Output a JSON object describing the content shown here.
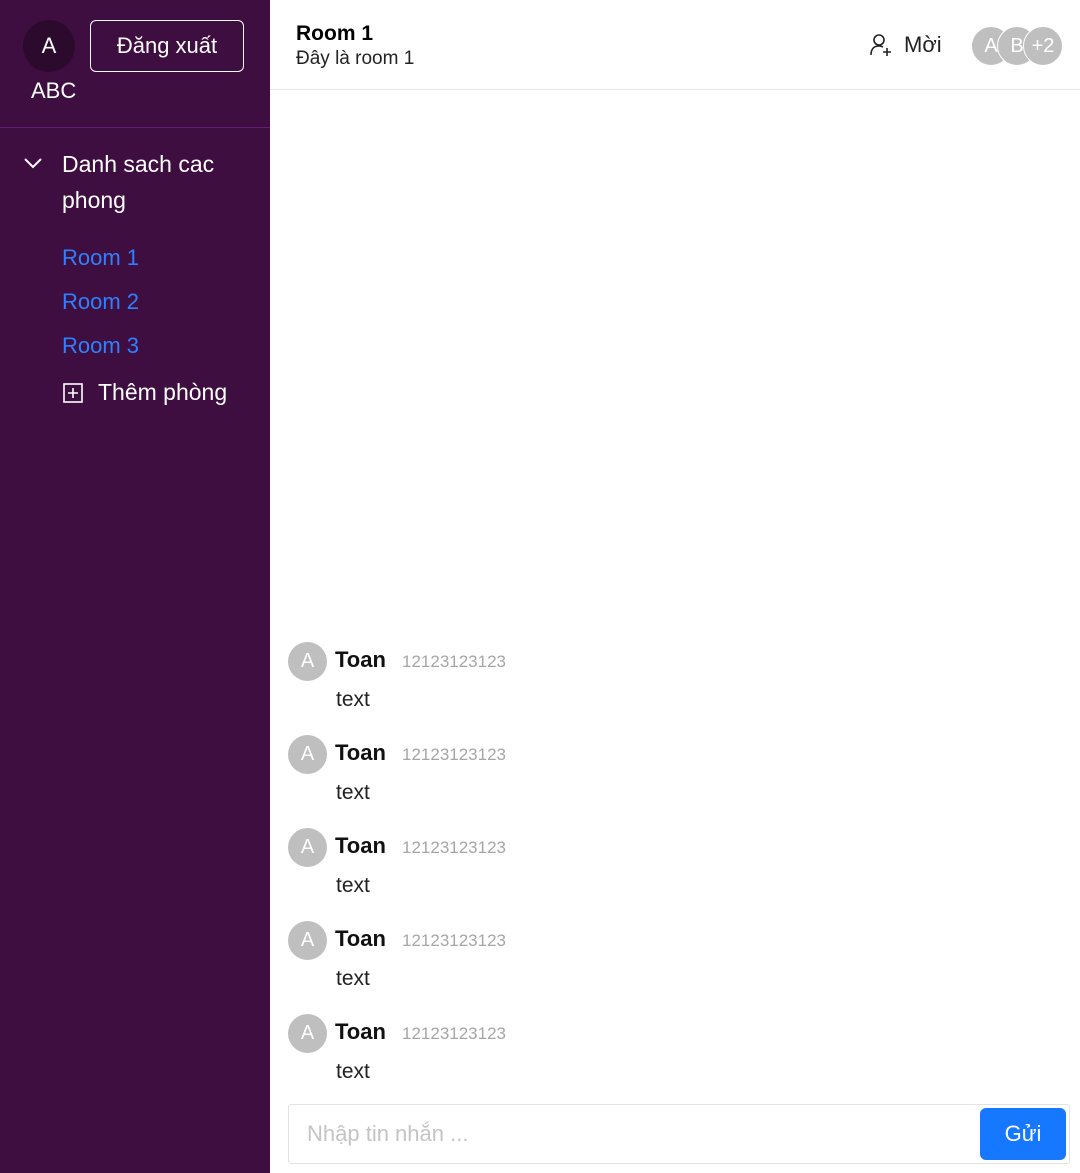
{
  "sidebar": {
    "user": {
      "avatar_letter": "A",
      "name": "ABC"
    },
    "logout_label": "Đăng xuất",
    "rooms_title": "Danh sach cac phong",
    "rooms": [
      {
        "label": "Room 1"
      },
      {
        "label": "Room 2"
      },
      {
        "label": "Room 3"
      }
    ],
    "add_room_label": "Thêm phòng",
    "colors": {
      "background": "#3f0e40",
      "room_link": "#2f80ff"
    }
  },
  "header": {
    "room_title": "Room 1",
    "room_description": "Đây là room 1",
    "invite_label": "Mời",
    "members": [
      "A",
      "B"
    ],
    "members_more": "+2"
  },
  "messages": [
    {
      "avatar": "A",
      "author": "Toan",
      "time": "12123123123",
      "text": "text"
    },
    {
      "avatar": "A",
      "author": "Toan",
      "time": "12123123123",
      "text": "text"
    },
    {
      "avatar": "A",
      "author": "Toan",
      "time": "12123123123",
      "text": "text"
    },
    {
      "avatar": "A",
      "author": "Toan",
      "time": "12123123123",
      "text": "text"
    },
    {
      "avatar": "A",
      "author": "Toan",
      "time": "12123123123",
      "text": "text"
    }
  ],
  "composer": {
    "placeholder": "Nhập tin nhắn ...",
    "value": "",
    "send_label": "Gửi",
    "accent": "#1677ff"
  }
}
